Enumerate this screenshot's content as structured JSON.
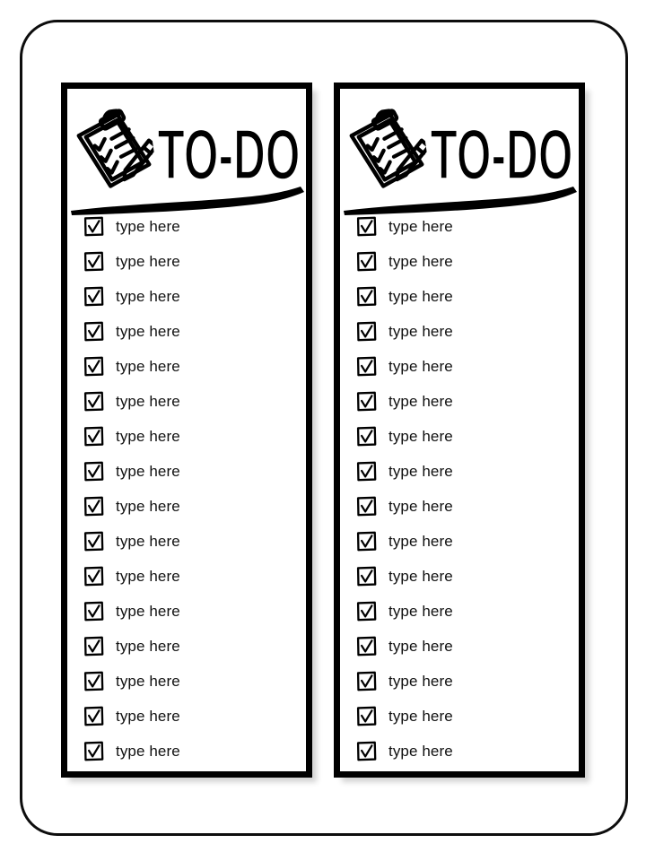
{
  "page": {
    "background_color": "#ffffff",
    "frame_color": "#0d0d0d",
    "ink_color": "#000000",
    "text_color": "#111111"
  },
  "cards": [
    {
      "name": "todo-card-left",
      "header": {
        "title": "TO-DO",
        "clipboard_icon": "clipboard-checklist-pencil-icon",
        "swoosh": "swoosh-underline-icon"
      },
      "rows": [
        {
          "checkbox": "checked",
          "label": "type here"
        },
        {
          "checkbox": "checked",
          "label": "type here"
        },
        {
          "checkbox": "checked",
          "label": "type here"
        },
        {
          "checkbox": "checked",
          "label": "type here"
        },
        {
          "checkbox": "checked",
          "label": "type here"
        },
        {
          "checkbox": "checked",
          "label": "type here"
        },
        {
          "checkbox": "checked",
          "label": "type here"
        },
        {
          "checkbox": "checked",
          "label": "type here"
        },
        {
          "checkbox": "checked",
          "label": "type here"
        },
        {
          "checkbox": "checked",
          "label": "type here"
        },
        {
          "checkbox": "checked",
          "label": "type here"
        },
        {
          "checkbox": "checked",
          "label": "type here"
        },
        {
          "checkbox": "checked",
          "label": "type here"
        },
        {
          "checkbox": "checked",
          "label": "type here"
        },
        {
          "checkbox": "checked",
          "label": "type here"
        },
        {
          "checkbox": "checked",
          "label": "type here"
        }
      ]
    },
    {
      "name": "todo-card-right",
      "header": {
        "title": "TO-DO",
        "clipboard_icon": "clipboard-checklist-pencil-icon",
        "swoosh": "swoosh-underline-icon"
      },
      "rows": [
        {
          "checkbox": "checked",
          "label": "type here"
        },
        {
          "checkbox": "checked",
          "label": "type here"
        },
        {
          "checkbox": "checked",
          "label": "type here"
        },
        {
          "checkbox": "checked",
          "label": "type here"
        },
        {
          "checkbox": "checked",
          "label": "type here"
        },
        {
          "checkbox": "checked",
          "label": "type here"
        },
        {
          "checkbox": "checked",
          "label": "type here"
        },
        {
          "checkbox": "checked",
          "label": "type here"
        },
        {
          "checkbox": "checked",
          "label": "type here"
        },
        {
          "checkbox": "checked",
          "label": "type here"
        },
        {
          "checkbox": "checked",
          "label": "type here"
        },
        {
          "checkbox": "checked",
          "label": "type here"
        },
        {
          "checkbox": "checked",
          "label": "type here"
        },
        {
          "checkbox": "checked",
          "label": "type here"
        },
        {
          "checkbox": "checked",
          "label": "type here"
        },
        {
          "checkbox": "checked",
          "label": "type here"
        }
      ]
    }
  ]
}
